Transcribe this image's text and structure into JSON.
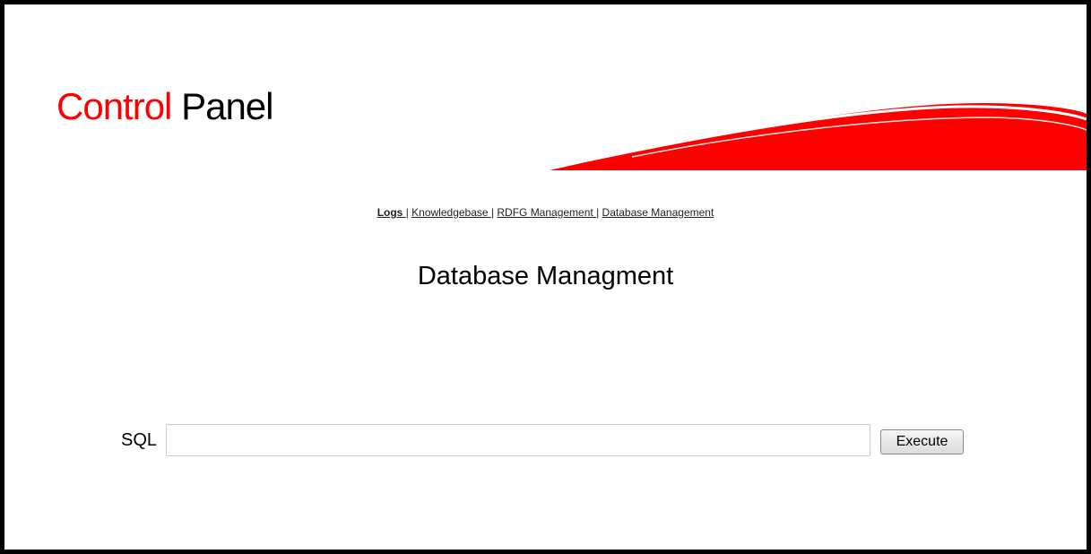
{
  "brand": {
    "accent_word": "Control",
    "rest_word": "Panel",
    "accent_color": "#ff0000"
  },
  "nav": {
    "items": [
      {
        "label": "Logs ",
        "active": true
      },
      {
        "label": "Knowledgebase ",
        "active": false
      },
      {
        "label": "RDFG Management ",
        "active": false
      },
      {
        "label": "Database Management",
        "active": false
      }
    ],
    "separator": "|"
  },
  "page": {
    "title": "Database Managment"
  },
  "sql_form": {
    "label": "SQL",
    "input_value": "",
    "execute_label": "Execute"
  },
  "decor": {
    "swoosh_color": "#ff0000",
    "frame_color": "#000000"
  }
}
